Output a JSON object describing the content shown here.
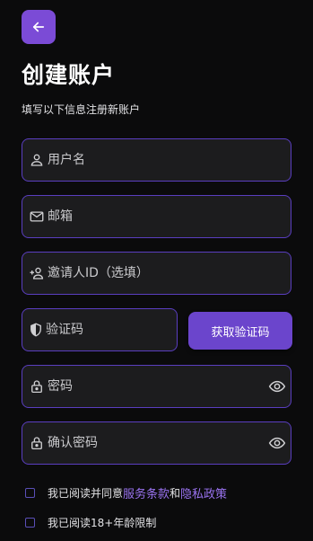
{
  "header": {
    "title": "创建账户",
    "subtitle": "填写以下信息注册新账户"
  },
  "form": {
    "username": {
      "placeholder": "用户名",
      "value": "",
      "icon": "user-icon"
    },
    "email": {
      "placeholder": "邮箱",
      "value": "",
      "icon": "mail-icon"
    },
    "invite": {
      "placeholder": "邀请人ID（选填）",
      "value": "",
      "icon": "person-add-icon"
    },
    "captcha": {
      "placeholder": "验证码",
      "value": "",
      "icon": "shield-icon"
    },
    "get_code_label": "获取验证码",
    "password": {
      "placeholder": "密码",
      "value": "",
      "icon": "lock-icon"
    },
    "confirm_password": {
      "placeholder": "确认密码",
      "value": "",
      "icon": "lock-icon"
    }
  },
  "agreements": {
    "terms_prefix": "我已阅读并同意",
    "terms_link": "服务条款",
    "terms_and": "和",
    "privacy_link": "隐私政策",
    "age_label": "我已阅读18+年龄限制"
  },
  "colors": {
    "accent": "#7b4bd6",
    "link": "#9a73f0",
    "field_border": "#5a3ec0",
    "background": "#0b0b0c"
  }
}
